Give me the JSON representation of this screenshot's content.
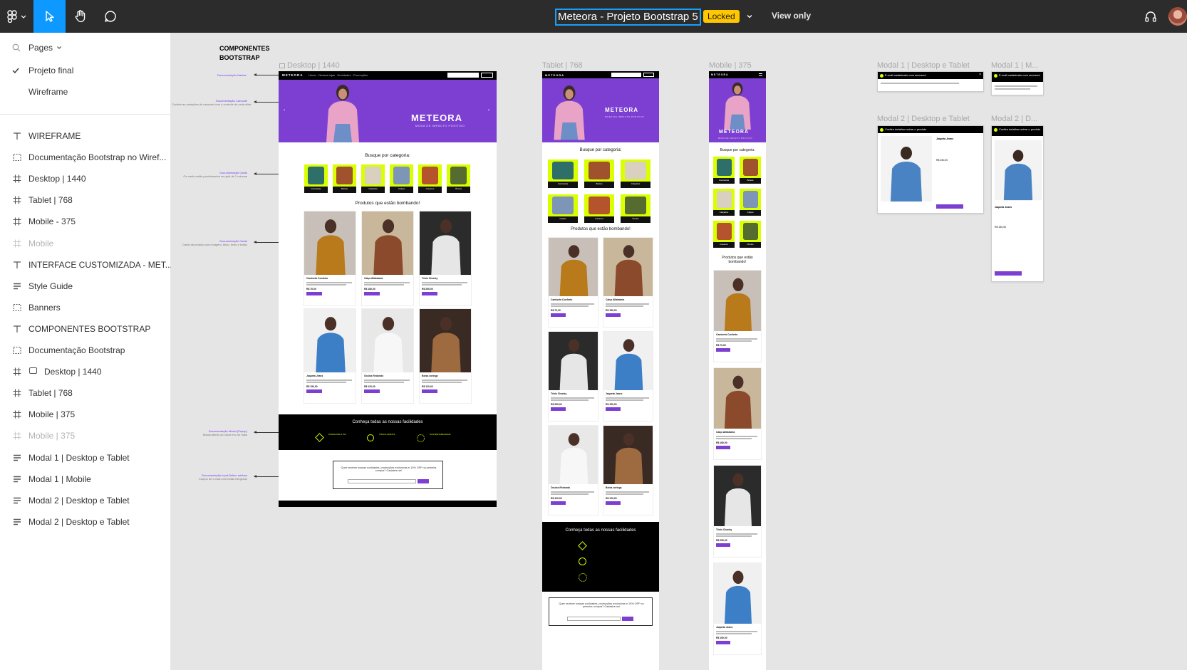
{
  "toolbar": {
    "file_title": "Meteora - Projeto Bootstrap 5",
    "locked_badge": "Locked",
    "view_only": "View only"
  },
  "pages": {
    "header": "Pages",
    "items": [
      {
        "label": "Projeto final",
        "selected": true
      },
      {
        "label": "Wireframe",
        "selected": false
      }
    ]
  },
  "layers": [
    {
      "label": "WIREFRAME",
      "icon": "text-icon",
      "dim": false
    },
    {
      "label": "Documentação Bootstrap no Wiref...",
      "icon": "section-icon",
      "dim": false
    },
    {
      "label": "Desktop | 1440",
      "icon": "frame-icon",
      "dim": false
    },
    {
      "label": "Tablet | 768",
      "icon": "frame-icon",
      "dim": false
    },
    {
      "label": "Mobile - 375",
      "icon": "frame-icon",
      "dim": false
    },
    {
      "label": "Mobile",
      "icon": "frame-icon",
      "dim": true
    },
    {
      "label": "INTERFACE CUSTOMIZADA - MET...",
      "icon": "text-icon",
      "dim": false
    },
    {
      "label": "Style Guide",
      "icon": "autolayout-icon",
      "dim": false,
      "bold": true
    },
    {
      "label": "Banners",
      "icon": "section-icon",
      "dim": false
    },
    {
      "label": "COMPONENTES BOOTSTRAP",
      "icon": "text-icon",
      "dim": false
    },
    {
      "label": "Documentação Bootstrap",
      "icon": "section-icon",
      "dim": false
    },
    {
      "label": "Desktop | 1440",
      "icon": "frame-icon",
      "dim": false,
      "bold": true,
      "sub_icon": "monitor-icon"
    },
    {
      "label": "Tablet | 768",
      "icon": "frame-icon",
      "dim": false,
      "bold": true
    },
    {
      "label": "Mobile | 375",
      "icon": "frame-icon",
      "dim": false,
      "bold": true
    },
    {
      "label": "Mobile | 375",
      "icon": "frame-icon",
      "dim": true
    },
    {
      "label": "Modal 1 | Desktop e Tablet",
      "icon": "autolayout-icon",
      "dim": false,
      "bold": true
    },
    {
      "label": "Modal 1 | Mobile",
      "icon": "autolayout-icon",
      "dim": false,
      "bold": true
    },
    {
      "label": "Modal 2 | Desktop e Tablet",
      "icon": "autolayout-icon",
      "dim": false,
      "bold": true
    },
    {
      "label": "Modal 2 | Desktop e Tablet",
      "icon": "autolayout-icon",
      "dim": false,
      "bold": true
    }
  ],
  "canvas": {
    "section_title": "COMPONENTES\nBOOTSTRAP",
    "frame_labels": {
      "desktop": "Desktop | 1440",
      "tablet": "Tablet | 768",
      "mobile": "Mobile | 375",
      "modal1_dt": "Modal 1 | Desktop e Tablet",
      "modal1_m": "Modal 1 | M...",
      "modal2_dt": "Modal 2 | Desktop e Tablet",
      "modal2_m": "Modal 2 | D..."
    },
    "site": {
      "logo": "METEORA",
      "tagline": "MODA DE IMPACTO POSITIVO",
      "categories_title": "Busque por categoria:",
      "products_title": "Produtos que estão bombando!",
      "mobile_products_title": "Produtos que estão\nbombando!",
      "facilities_title": "Conheça todas as nossas facilidades",
      "newsletter_text": "Quer receber nossas novidades, promoções exclusivas e 10% OFF na primeira compra? Cadastre-se!",
      "categories": [
        "Camisetas",
        "Bolsas",
        "Calçados",
        "Calças",
        "Casacos",
        "Óculos"
      ],
      "products": [
        {
          "name": "Camiseta Conforto",
          "price": "R$ 70,00"
        },
        {
          "name": "Calça Alfaiataria",
          "price": "R$ 180,00"
        },
        {
          "name": "Tênis Chunky",
          "price": "R$ 250,00"
        },
        {
          "name": "Jaqueta Jeans",
          "price": "R$ 150,00"
        },
        {
          "name": "Óculos Redondo",
          "price": "R$ 120,00"
        },
        {
          "name": "Bolsa coringa",
          "price": "R$ 120,00"
        }
      ],
      "tablet_products": [
        {
          "name": "Camiseta Conforto",
          "price": "R$ 70,00"
        },
        {
          "name": "Calça Alfaiataria",
          "price": "R$ 180,00"
        },
        {
          "name": "Tênis Chunky",
          "price": "R$ 250,00"
        },
        {
          "name": "Jaqueta Jeans",
          "price": "R$ 150,00"
        },
        {
          "name": "Óculos Redondo",
          "price": "R$ 120,00"
        },
        {
          "name": "Bolsa coringa",
          "price": "R$ 120,00"
        }
      ],
      "mobile_products": [
        {
          "name": "Camiseta Conforto",
          "price": "R$ 70,00"
        },
        {
          "name": "Calça Alfaiataria",
          "price": "R$ 180,00"
        },
        {
          "name": "Tênis Chunky",
          "price": "R$ 250,00"
        },
        {
          "name": "Jaqueta Jeans",
          "price": "R$ 150,00"
        }
      ]
    },
    "modal1_title": "E-mail cadastrado com sucesso!",
    "modal1_m_title": "E-mail cadastrado com sucesso!",
    "modal2_title": "Confira detalhes sobre o produto",
    "modal2_m_title": "Confira detalhes sobre o produto",
    "modal2_product": "Jaqueta Jeans",
    "modal2_price": "R$ 150,00"
  },
  "colors": {
    "toolbar_bg": "#2c2c2c",
    "accent_blue": "#18a0fb",
    "locked_yellow": "#ffc700",
    "brand_purple": "#7c3fd1",
    "brand_lime": "#d9ff00"
  }
}
